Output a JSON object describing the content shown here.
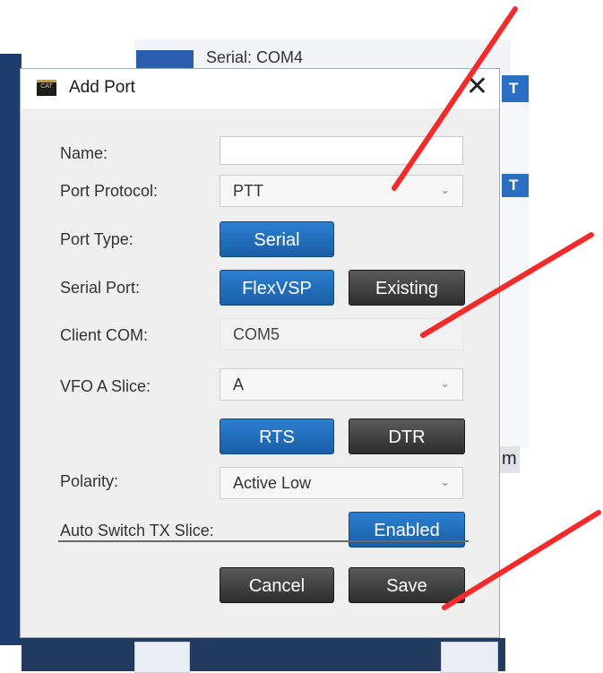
{
  "background": {
    "serial_label": "Serial: COM4",
    "right_letter": "T",
    "right_letter_2": "T",
    "partial_letter": "m"
  },
  "dialog": {
    "title": "Add Port",
    "close_glyph": "✕",
    "app_icon_text": "CAT",
    "fields": {
      "name_label": "Name:",
      "name_value": "",
      "protocol_label": "Port Protocol:",
      "protocol_value": "PTT",
      "type_label": "Port Type:",
      "type_button": "Serial",
      "serial_port_label": "Serial Port:",
      "flexvsp_button": "FlexVSP",
      "existing_button": "Existing",
      "client_com_label": "Client COM:",
      "client_com_value": "COM5",
      "vfo_label": "VFO A Slice:",
      "vfo_value": "A",
      "rts_button": "RTS",
      "dtr_button": "DTR",
      "polarity_label": "Polarity:",
      "polarity_value": "Active Low",
      "auto_switch_label": "Auto Switch TX Slice:",
      "auto_switch_button": "Enabled"
    },
    "footer": {
      "cancel_label": "Cancel",
      "save_label": "Save"
    }
  },
  "colors": {
    "accent_blue": "#1f6fc0",
    "dark_button": "#3a3a3a",
    "annotation_red": "#f22a2a"
  }
}
